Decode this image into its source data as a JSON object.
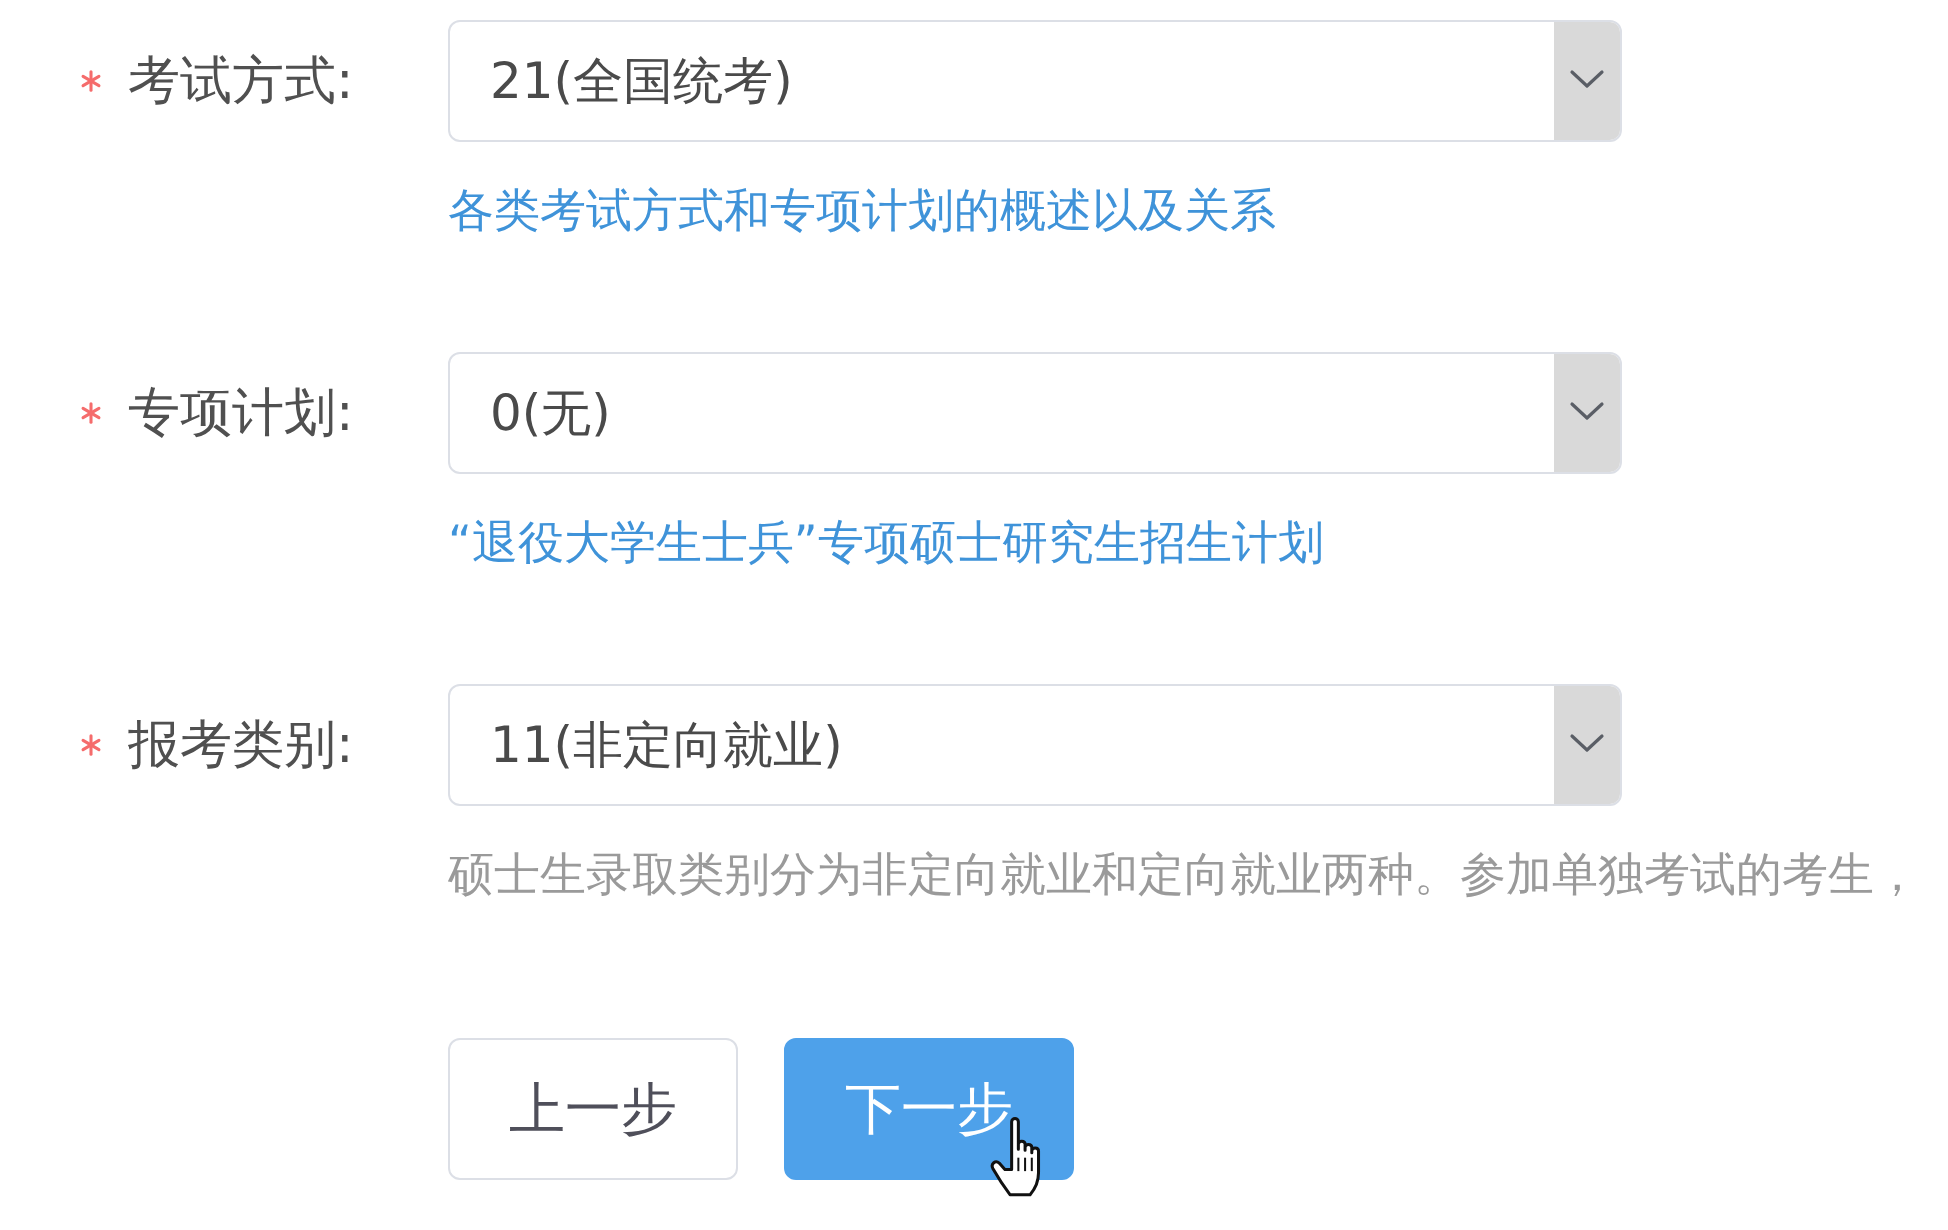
{
  "form": {
    "fields": [
      {
        "label": "考试方式:",
        "required": true,
        "value": "21(全国统考)",
        "help": {
          "kind": "link",
          "text": "各类考试方式和专项计划的概述以及关系"
        }
      },
      {
        "label": "专项计划:",
        "required": true,
        "value": "0(无)",
        "help": {
          "kind": "link",
          "text": "“退役大学生士兵”专项硕士研究生招生计划"
        }
      },
      {
        "label": "报考类别:",
        "required": true,
        "value": "11(非定向就业)",
        "help": {
          "kind": "note",
          "text": "硕士生录取类别分为非定向就业和定向就业两种。参加单独考试的考生，"
        }
      }
    ]
  },
  "buttons": [
    {
      "label": "上一步",
      "kind": "default",
      "hovered": false
    },
    {
      "label": "下一步",
      "kind": "primary",
      "hovered": true
    }
  ]
}
